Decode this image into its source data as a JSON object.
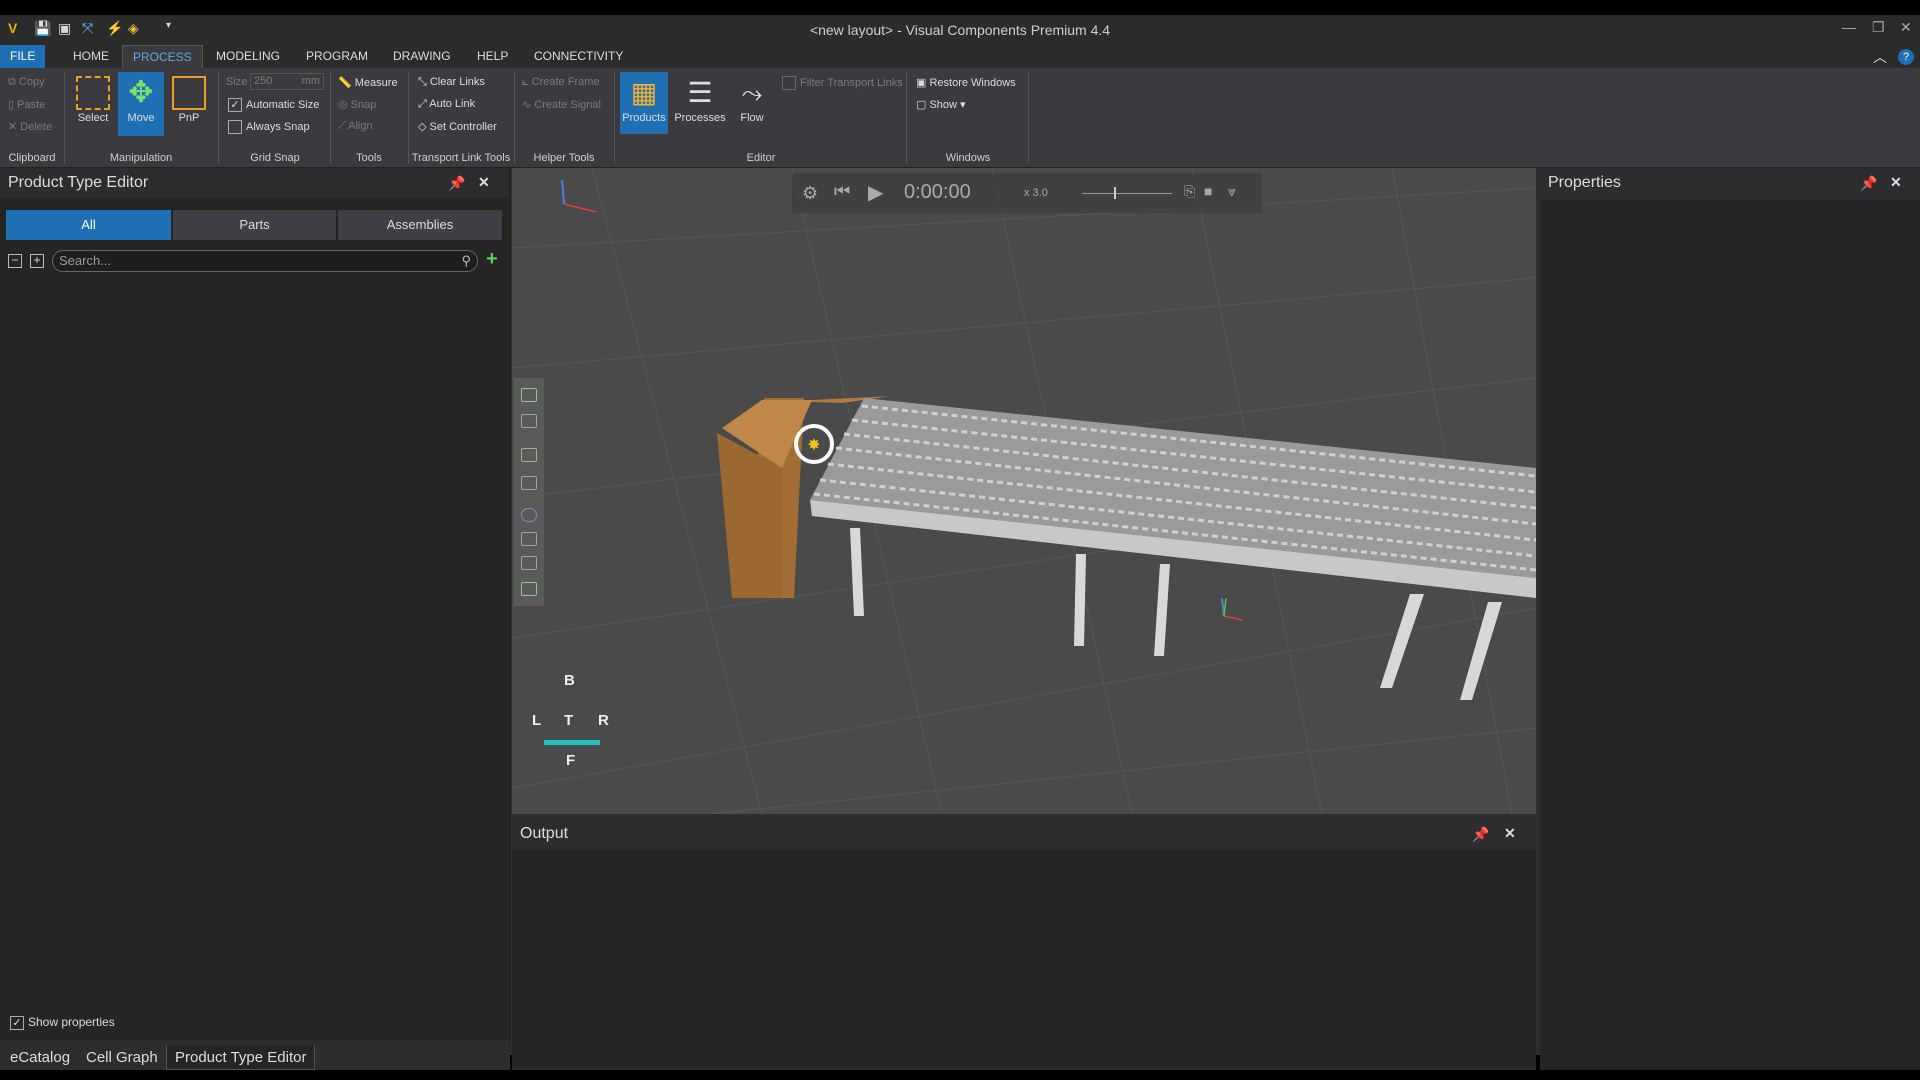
{
  "window": {
    "title": "<new layout> - Visual Components Premium 4.4"
  },
  "menu": {
    "items": [
      "FILE",
      "HOME",
      "PROCESS",
      "MODELING",
      "PROGRAM",
      "DRAWING",
      "HELP",
      "CONNECTIVITY"
    ]
  },
  "ribbon": {
    "clipboard": {
      "copy": "Copy",
      "paste": "Paste",
      "delete": "Delete",
      "label": "Clipboard"
    },
    "manipulation": {
      "select": "Select",
      "move": "Move",
      "pnp": "PnP",
      "label": "Manipulation"
    },
    "grid_snap": {
      "size_label": "Size",
      "size_value": "250",
      "size_unit": "mm",
      "automatic_size": "Automatic Size",
      "always_snap": "Always Snap",
      "label": "Grid Snap"
    },
    "tools": {
      "measure": "Measure",
      "snap": "Snap",
      "align": "Align",
      "label": "Tools"
    },
    "transport": {
      "clear_links": "Clear Links",
      "auto_link": "Auto Link",
      "set_controller": "Set Controller",
      "label": "Transport Link Tools"
    },
    "helper": {
      "create_frame": "Create Frame",
      "create_signal": "Create Signal",
      "label": "Helper Tools"
    },
    "editor": {
      "products": "Products",
      "processes": "Processes",
      "flow": "Flow",
      "filter": "Filter Transport Links",
      "label": "Editor"
    },
    "windows": {
      "restore": "Restore Windows",
      "show": "Show ▾",
      "label": "Windows"
    }
  },
  "left_panel": {
    "title": "Product Type Editor",
    "tabs": [
      "All",
      "Parts",
      "Assemblies"
    ],
    "search_placeholder": "Search...",
    "show_properties": "Show properties"
  },
  "bottom_tabs": [
    "eCatalog",
    "Cell Graph",
    "Product Type Editor"
  ],
  "viewport": {
    "time": "0:00:00",
    "speed": "x 3.0",
    "cube": {
      "top": "T",
      "back": "B",
      "left": "L",
      "right": "R",
      "front": "F"
    }
  },
  "output_panel": {
    "title": "Output"
  },
  "properties_panel": {
    "title": "Properties"
  },
  "colors": {
    "accent": "#1f6fb5",
    "background": "#2d2d30"
  }
}
